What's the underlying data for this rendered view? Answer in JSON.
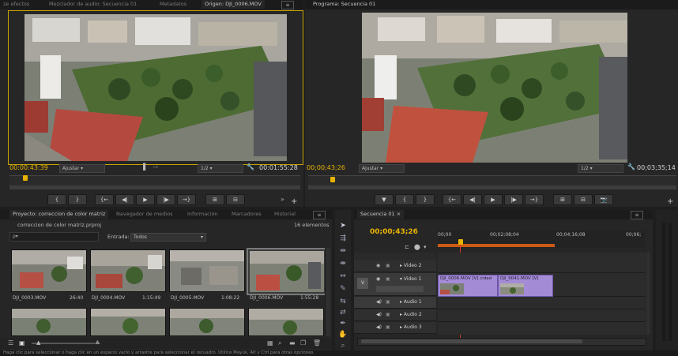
{
  "source_monitor": {
    "tabs": [
      "ze efectos",
      "Mezclador de audio: Secuencia 01",
      "Metadatos",
      "Origen: DJI_0006.MOV"
    ],
    "timecode_in": "00:00:43:39",
    "fit_label": "Ajustar",
    "resolution": "1/2",
    "duration": "00:01:55:28"
  },
  "program_monitor": {
    "tab": "Programa: Secuencia 01",
    "timecode_in": "00;00;43;26",
    "fit_label": "Ajustar",
    "resolution": "1/2",
    "duration": "00;03;35;14"
  },
  "transport": [
    "{",
    "}",
    "{←",
    "◀|",
    "▶",
    "|▶",
    "→}",
    "⊞",
    "⊟",
    "📷"
  ],
  "project": {
    "tabs": [
      "Proyecto: correccion de color matriz",
      "Navegador de medios",
      "Información",
      "Marcadores",
      "Historial"
    ],
    "file_name": "correccion de color matriz.prproj",
    "count": "16 elementos",
    "search_placeholder": "ρ▾",
    "entrada_label": "Entrada:",
    "entrada_value": "Todos",
    "clips": [
      {
        "name": "DJI_0003.MOV",
        "duration": "26:40"
      },
      {
        "name": "DJI_0004.MOV",
        "duration": "1:15:49"
      },
      {
        "name": "DJI_0005.MOV",
        "duration": "1:08:22"
      },
      {
        "name": "DJI_0006.MOV",
        "duration": "1:55:28"
      }
    ]
  },
  "timeline": {
    "tab": "Secuencia 01",
    "timecode": "00;00;43;26",
    "ruler": [
      "00;00",
      "00;02;08;04",
      "00;04;16;08",
      "00;06;"
    ],
    "tracks": {
      "video2": "Video 2",
      "video1": "Video 1",
      "audio1": "Audio 1",
      "audio2": "Audio 2",
      "audio3": "Audio 3",
      "v_label": "V"
    },
    "clip1": "DJI_0006.MOV [V] cidad",
    "clip2": "DJI_0041.MOV [V]"
  },
  "status_bar": "Haga clic para seleccionar o haga clic en un espacio vacío y arrastre para seleccionar el recuadro. Utilice Mayús, Alt y Ctrl para otras opciones."
}
